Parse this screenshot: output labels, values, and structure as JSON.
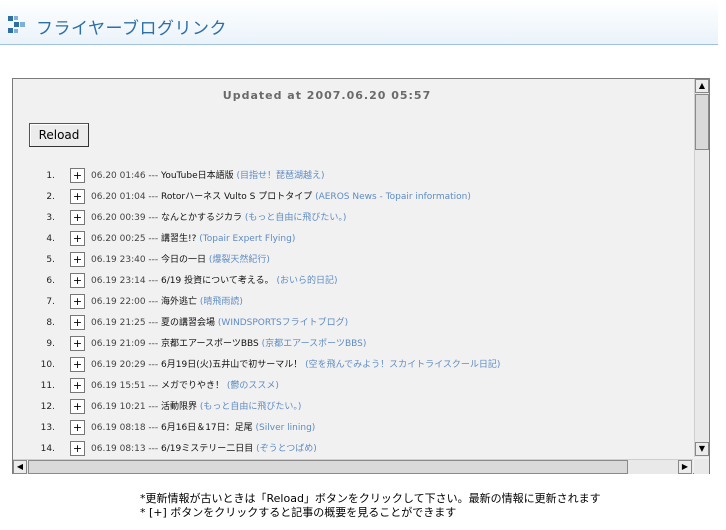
{
  "header": {
    "title": "フライヤーブログリンク"
  },
  "updated": "Updated at 2007.06.20 05:57",
  "reload_label": "Reload",
  "plus_label": "+",
  "items": [
    {
      "num": "1.",
      "time": "06.20 01:46 --- ",
      "title": "YouTube日本語版",
      "source": " (目指せ！琵琶湖越え)"
    },
    {
      "num": "2.",
      "time": "06.20 01:04 --- ",
      "title": "Rotorハーネス Vulto S プロトタイプ",
      "source": " (AEROS News - Topair information)"
    },
    {
      "num": "3.",
      "time": "06.20 00:39 --- ",
      "title": "なんとかするジカラ",
      "source": " (もっと自由に飛びたい。)"
    },
    {
      "num": "4.",
      "time": "06.20 00:25 --- ",
      "title": "講習生!?",
      "source": " (Topair Expert Flying)"
    },
    {
      "num": "5.",
      "time": "06.19 23:40 --- ",
      "title": "今日の一日",
      "source": " (爆裂天然紀行)"
    },
    {
      "num": "6.",
      "time": "06.19 23:14 --- ",
      "title": "6/19 投資について考える。",
      "source": " (おいら的日記)"
    },
    {
      "num": "7.",
      "time": "06.19 22:00 --- ",
      "title": "海外逃亡",
      "source": " (晴飛雨読)"
    },
    {
      "num": "8.",
      "time": "06.19 21:25 --- ",
      "title": "夏の講習会場",
      "source": " (WINDSPORTSフライトブログ)"
    },
    {
      "num": "9.",
      "time": "06.19 21:09 --- ",
      "title": "京都エアースポーツBBS",
      "source": " (京都エアースポーツBBS)"
    },
    {
      "num": "10.",
      "time": "06.19 20:29 --- ",
      "title": "6月19日(火)五井山で初サーマル！",
      "source": " (空を飛んでみよう！スカイトライスクール日記)"
    },
    {
      "num": "11.",
      "time": "06.19 15:51 --- ",
      "title": "メガでりやき！",
      "source": " (鬱のススメ)"
    },
    {
      "num": "12.",
      "time": "06.19 10:21 --- ",
      "title": "活動限界",
      "source": " (もっと自由に飛びたい。)"
    },
    {
      "num": "13.",
      "time": "06.19 08:18 --- ",
      "title": "6月16日＆17日：足尾",
      "source": " (Silver lining)"
    },
    {
      "num": "14.",
      "time": "06.19 08:13 --- ",
      "title": "6/19ミステリー二日目",
      "source": " (ぞうとつばめ)"
    }
  ],
  "notes": [
    "*更新情報が古いときは「Reload」ボタンをクリックして下さい。最新の情報に更新されます",
    "* [+] ボタンをクリックすると記事の概要を見ることができます"
  ],
  "colors": {
    "accent": "#2e6fa6",
    "source_link": "#5e8cc4",
    "panel_bg": "#f1f1f1"
  },
  "icons": {
    "header": "blue-chevron-icon"
  }
}
